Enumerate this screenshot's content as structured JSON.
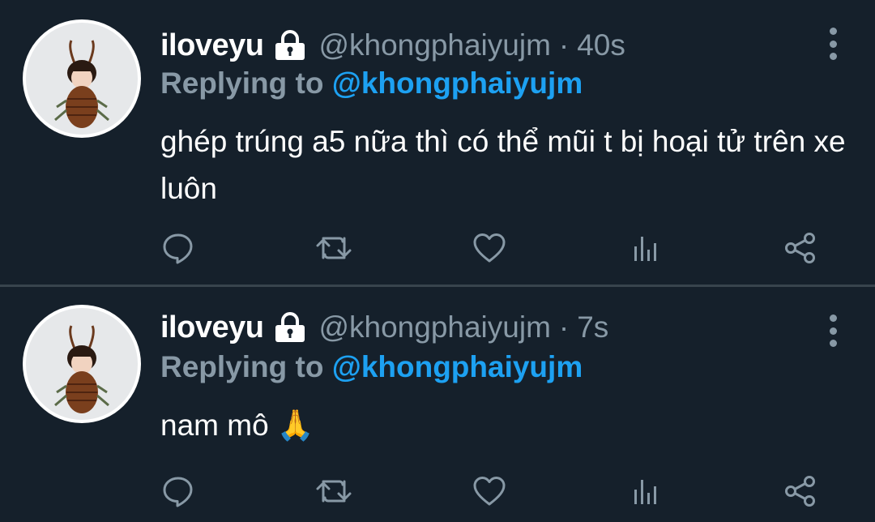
{
  "colors": {
    "background": "#15202b",
    "divider": "#38444d",
    "secondary_text": "#8899a6",
    "link": "#1da1f2",
    "primary_text": "#ffffff"
  },
  "tweets": [
    {
      "display_name": "iloveyu",
      "handle": "@khongphaiyujm",
      "separator": "·",
      "time": "40s",
      "reply_prefix": "Replying to",
      "reply_to": "@khongphaiyujm",
      "text": "ghép trúng a5 nữa thì có thể mũi t bị hoại tử trên xe luôn",
      "icons": [
        "lock-icon",
        "more-vertical-icon",
        "reply-icon",
        "retweet-icon",
        "like-icon",
        "analytics-icon",
        "share-icon"
      ]
    },
    {
      "display_name": "iloveyu",
      "handle": "@khongphaiyujm",
      "separator": "·",
      "time": "7s",
      "reply_prefix": "Replying to",
      "reply_to": "@khongphaiyujm",
      "text": "nam mô 🙏",
      "icons": [
        "lock-icon",
        "more-vertical-icon",
        "reply-icon",
        "retweet-icon",
        "like-icon",
        "analytics-icon",
        "share-icon"
      ]
    }
  ]
}
